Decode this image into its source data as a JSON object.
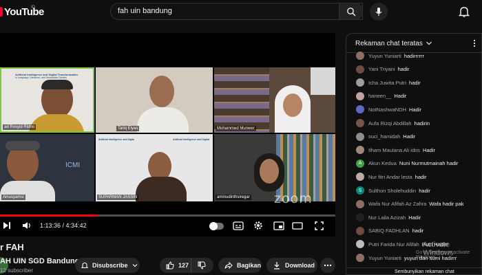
{
  "header": {
    "logo_text": "YouTube",
    "region": "ID",
    "search_value": "fah uin bandung"
  },
  "player": {
    "participants": [
      {
        "name": "ad Rosyid Ridho",
        "bg": "#e8e4df",
        "border": "#7ac943"
      },
      {
        "name": "Tariq Elyas",
        "bg": "#d4cbc0"
      },
      {
        "name": "Mohammed Munwer",
        "bg": "#5b4a3c"
      },
      {
        "name": "Ainusyamsi",
        "bg": "#2d3440"
      },
      {
        "name": "SUPARMAN JASSIN",
        "bg": "#e7e6e8"
      },
      {
        "name": "aminudinthsiregar",
        "bg": "#3a3a38"
      }
    ],
    "banner_line1": "Artificial Intelligence and Digital Transformation",
    "banner_line2": "in Language, Literature, and Humanities Studies",
    "zoom_watermark": "zoom",
    "zoom_sub": "",
    "progress": 0.29,
    "time_current": "1:13:36",
    "time_total": "4:34:42",
    "time_sep": " / "
  },
  "video": {
    "title": "r FAH",
    "channel": "AH UIN SGD Bandung",
    "subscribers": "12 subscriber",
    "subscribe_label": "Disubscribe",
    "likes": "127",
    "share_label": "Bagikan",
    "download_label": "Download"
  },
  "chat": {
    "title": "Rekaman chat teratas",
    "footer": "Sembunyikan rekaman chat",
    "messages": [
      {
        "author": "Yuyun Yuniarti",
        "text": "hadirrrrrr",
        "color": "#8d6e63"
      },
      {
        "author": "Yani Triyani",
        "text": "hadir",
        "color": "#6d4c41"
      },
      {
        "author": "Icha Juwita Putri",
        "text": "hadir",
        "color": "#9e9e9e"
      },
      {
        "author": "haneen__",
        "text": "Hadir",
        "color": "#c2a3a3"
      },
      {
        "author": "NotNashwaNDH",
        "text": "Hadir",
        "color": "#5c6bc0"
      },
      {
        "author": "Aufa Rizqi Abdillah",
        "text": "hadirin",
        "color": "#795548"
      },
      {
        "author": "suci_hamidah",
        "text": "Hadir",
        "color": "#8e8e8e"
      },
      {
        "author": "Ilham Maulana Ali idris",
        "text": "Hadir",
        "color": "#a1887f"
      },
      {
        "author": "Akun Kedua",
        "text": "Nuni Nurmutmainah hadir",
        "color": "#43a047",
        "initial": "A"
      },
      {
        "author": "Nur fitri Andar lesta",
        "text": "hadir",
        "color": "#bcaaa4"
      },
      {
        "author": "Sulthon Sholehuddin",
        "text": "hadir",
        "color": "#00897b",
        "initial": "S"
      },
      {
        "author": "Wafa Nur Afifah Az Zahra",
        "text": "Wafa hadir pak",
        "color": "#8d6e63"
      },
      {
        "author": "Nur Laila Azizah",
        "text": "Hadir",
        "color": "#212121"
      },
      {
        "author": "SABIQ FADHLAN",
        "text": "hadir",
        "color": "#6d4c41"
      },
      {
        "author": "Putri Farida Nur Afifah",
        "text": "Putri Hadirr",
        "color": "#bdbdbd"
      },
      {
        "author": "Yuyun Yuniarti",
        "text": "yuyun dan sumi hadirrr",
        "color": "#8d6e63"
      }
    ]
  },
  "overlay": {
    "activate_line1": "Activate Windows",
    "activate_line2": "Go to Settings to activate Windows."
  }
}
